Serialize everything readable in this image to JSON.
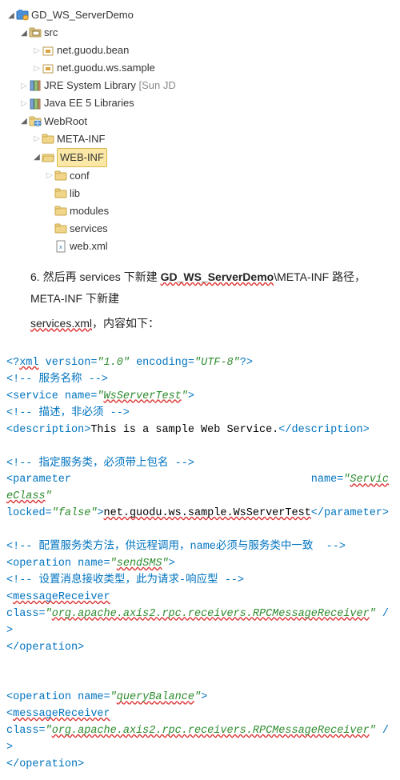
{
  "tree": {
    "root": "GD_WS_ServerDemo",
    "src": "src",
    "pkg1": "net.guodu.bean",
    "pkg2": "net.guodu.ws.sample",
    "jre": "JRE System Library",
    "jre_suffix": "[Sun JD",
    "javaee": "Java EE 5 Libraries",
    "webroot": "WebRoot",
    "metainf": "META-INF",
    "webinf": "WEB-INF",
    "conf": "conf",
    "lib": "lib",
    "modules": "modules",
    "services": "services",
    "webxml": "web.xml"
  },
  "para": {
    "line1_a": "6. 然后再 services 下新建 GD_WS_ServerDemo\\META-INF 路径，META-INF 下新建",
    "line2": "services.xml，内容如下："
  },
  "xml": {
    "l1": {
      "pre": "<?xml ",
      "a1": "version",
      "v1": "\"1.0\"",
      "a2": "encoding",
      "v2": "\"UTF-8\"",
      "suf": "?>"
    },
    "l2": "<!-- 服务名称 -->",
    "l3": {
      "open": "<service ",
      "attr": "name",
      "val": "\"WsServerTest\"",
      "close": ">"
    },
    "l4": "<!-- 描述，非必须 -->",
    "l5": {
      "open": "<description>",
      "text": "This is a sample Web Service.",
      "close": "</description>"
    },
    "l6": "<!-- 指定服务类，必须带上包名 -->",
    "l7": {
      "open": "<parameter ",
      "a1": "name",
      "v1": "\"ServiceClass\"",
      "a2": "locked",
      "v2": "\"false\"",
      "close": ">",
      "text": "net.guodu.ws.sample.WsServerTest",
      "end": "</parameter>"
    },
    "l8": "<!-- 配置服务类方法，供远程调用，name必须与服务类中一致  -->",
    "l9": {
      "open": "<operation ",
      "attr": "name",
      "val": "\"sendSMS\"",
      "close": ">"
    },
    "l10": "<!-- 设置消息接收类型，此为请求-响应型 -->",
    "l11": {
      "open": "<messageReceiver",
      "br": "",
      "attr": "class",
      "val": "\"org.apache.axis2.rpc.receivers.RPCMessageReceiver\"",
      "close": " />"
    },
    "l12": "</operation>",
    "l13": {
      "open": "<operation ",
      "attr": "name",
      "val": "\"queryBalance\"",
      "close": ">"
    },
    "l14": {
      "open": "<messageReceiver",
      "attr": "class",
      "val": "\"org.apache.axis2.rpc.receivers.RPCMessageReceiver\"",
      "close": " />"
    },
    "l15": "</operation>"
  }
}
